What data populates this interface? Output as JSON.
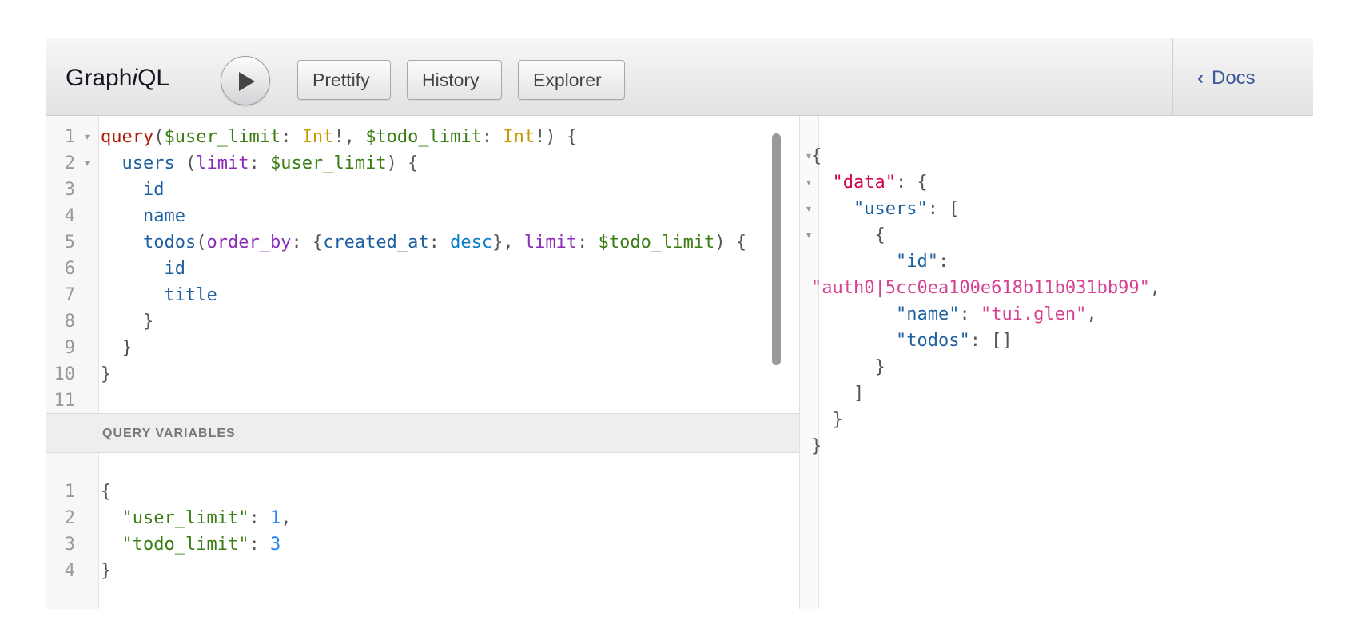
{
  "toolbar": {
    "title_prefix": "Graph",
    "title_italic": "i",
    "title_suffix": "QL",
    "prettify_label": "Prettify",
    "history_label": "History",
    "explorer_label": "Explorer",
    "docs_label": "Docs",
    "docs_chevron": "‹"
  },
  "query_editor": {
    "line_numbers": [
      "1",
      "2",
      "3",
      "4",
      "5",
      "6",
      "7",
      "8",
      "9",
      "10",
      "11"
    ],
    "lines": [
      [
        {
          "t": "query",
          "c": "kw"
        },
        {
          "t": "(",
          "c": "pun"
        },
        {
          "t": "$user_limit",
          "c": "var"
        },
        {
          "t": ": ",
          "c": "pun"
        },
        {
          "t": "Int",
          "c": "type"
        },
        {
          "t": "!, ",
          "c": "pun"
        },
        {
          "t": "$todo_limit",
          "c": "var"
        },
        {
          "t": ": ",
          "c": "pun"
        },
        {
          "t": "Int",
          "c": "type"
        },
        {
          "t": "!) {",
          "c": "pun"
        }
      ],
      [
        {
          "t": "  ",
          "c": "pun"
        },
        {
          "t": "users",
          "c": "prop"
        },
        {
          "t": " (",
          "c": "pun"
        },
        {
          "t": "limit",
          "c": "arg"
        },
        {
          "t": ": ",
          "c": "pun"
        },
        {
          "t": "$user_limit",
          "c": "var"
        },
        {
          "t": ") {",
          "c": "pun"
        }
      ],
      [
        {
          "t": "    ",
          "c": "pun"
        },
        {
          "t": "id",
          "c": "prop"
        }
      ],
      [
        {
          "t": "    ",
          "c": "pun"
        },
        {
          "t": "name",
          "c": "prop"
        }
      ],
      [
        {
          "t": "    ",
          "c": "pun"
        },
        {
          "t": "todos",
          "c": "prop"
        },
        {
          "t": "(",
          "c": "pun"
        },
        {
          "t": "order_by",
          "c": "arg"
        },
        {
          "t": ": {",
          "c": "pun"
        },
        {
          "t": "created_at",
          "c": "prop"
        },
        {
          "t": ": ",
          "c": "pun"
        },
        {
          "t": "desc",
          "c": "enum"
        },
        {
          "t": "}, ",
          "c": "pun"
        },
        {
          "t": "limit",
          "c": "arg"
        },
        {
          "t": ": ",
          "c": "pun"
        },
        {
          "t": "$todo_limit",
          "c": "var"
        },
        {
          "t": ") {",
          "c": "pun"
        }
      ],
      [
        {
          "t": "      ",
          "c": "pun"
        },
        {
          "t": "id",
          "c": "prop"
        }
      ],
      [
        {
          "t": "      ",
          "c": "pun"
        },
        {
          "t": "title",
          "c": "prop"
        }
      ],
      [
        {
          "t": "    }",
          "c": "pun"
        }
      ],
      [
        {
          "t": "  }",
          "c": "pun"
        }
      ],
      [
        {
          "t": "}",
          "c": "pun"
        }
      ],
      [
        {
          "t": "",
          "c": "pun"
        }
      ]
    ],
    "folded_lines": [
      0,
      1
    ]
  },
  "query_variables": {
    "header": "QUERY VARIABLES",
    "line_numbers": [
      "1",
      "2",
      "3",
      "4"
    ],
    "lines": [
      [
        {
          "t": "{",
          "c": "pun"
        }
      ],
      [
        {
          "t": "  ",
          "c": "pun"
        },
        {
          "t": "\"user_limit\"",
          "c": "var"
        },
        {
          "t": ": ",
          "c": "pun"
        },
        {
          "t": "1",
          "c": "num-v"
        },
        {
          "t": ",",
          "c": "pun"
        }
      ],
      [
        {
          "t": "  ",
          "c": "pun"
        },
        {
          "t": "\"todo_limit\"",
          "c": "var"
        },
        {
          "t": ": ",
          "c": "pun"
        },
        {
          "t": "3",
          "c": "num-v"
        }
      ],
      [
        {
          "t": "}",
          "c": "pun"
        }
      ]
    ]
  },
  "result": {
    "lines": [
      [
        {
          "t": "{",
          "c": "pun"
        }
      ],
      [
        {
          "t": "  ",
          "c": "pun"
        },
        {
          "t": "\"data\"",
          "c": "rkey-red"
        },
        {
          "t": ": {",
          "c": "pun"
        }
      ],
      [
        {
          "t": "    ",
          "c": "pun"
        },
        {
          "t": "\"users\"",
          "c": "rkey"
        },
        {
          "t": ": [",
          "c": "pun"
        }
      ],
      [
        {
          "t": "      {",
          "c": "pun"
        }
      ],
      [
        {
          "t": "        ",
          "c": "pun"
        },
        {
          "t": "\"id\"",
          "c": "rkey"
        },
        {
          "t": ":",
          "c": "pun"
        }
      ],
      [
        {
          "t": "\"auth0|5cc0ea100e618b11b031bb99\"",
          "c": "rstr"
        },
        {
          "t": ",",
          "c": "pun"
        }
      ],
      [
        {
          "t": "        ",
          "c": "pun"
        },
        {
          "t": "\"name\"",
          "c": "rkey"
        },
        {
          "t": ": ",
          "c": "pun"
        },
        {
          "t": "\"tui.glen\"",
          "c": "rstr"
        },
        {
          "t": ",",
          "c": "pun"
        }
      ],
      [
        {
          "t": "        ",
          "c": "pun"
        },
        {
          "t": "\"todos\"",
          "c": "rkey"
        },
        {
          "t": ": []",
          "c": "pun"
        }
      ],
      [
        {
          "t": "      }",
          "c": "pun"
        }
      ],
      [
        {
          "t": "    ]",
          "c": "pun"
        }
      ],
      [
        {
          "t": "  }",
          "c": "pun"
        }
      ],
      [
        {
          "t": "}",
          "c": "pun"
        }
      ]
    ],
    "folded_lines": [
      0,
      1,
      2,
      3
    ]
  }
}
